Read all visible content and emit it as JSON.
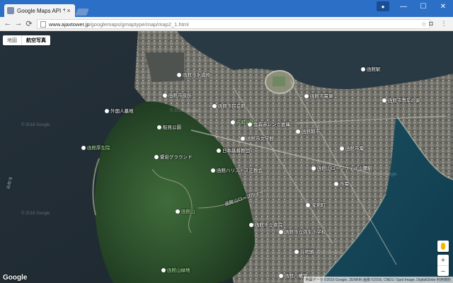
{
  "browser": {
    "tab_title": "Google Maps API サンプル",
    "tab_close": "×",
    "url_domain": "www.ajaxtower.jp",
    "url_path": "/googlemaps/gmaptype/map/map2_1.html",
    "window_minimize": "—",
    "window_maximize": "☐",
    "window_close": "✕",
    "back": "←",
    "forward": "→",
    "reload": "⟳",
    "star": "☆"
  },
  "map": {
    "type_controls": [
      "地図",
      "航空写真"
    ],
    "selected_type": "航空写真",
    "labels": [
      {
        "text": "函館市水道局"
      },
      {
        "text": "函館市役所"
      },
      {
        "text": "函館市民会館"
      },
      {
        "text": "函館市電車"
      },
      {
        "text": "函館市青年の家"
      },
      {
        "text": "外国人墓地"
      },
      {
        "text": "船見公園"
      },
      {
        "text": "函館厚生院"
      },
      {
        "text": "愛宕グラウンド"
      },
      {
        "text": "函館ハリストス正教会"
      },
      {
        "text": "日本基督教団"
      },
      {
        "text": "元町公園"
      },
      {
        "text": "函館山ロープウェイ"
      },
      {
        "text": "函館山"
      },
      {
        "text": "函館市立病院"
      },
      {
        "text": "函館山緑地"
      },
      {
        "text": "函館市立弥生小学校"
      },
      {
        "text": "函館朝市"
      },
      {
        "text": "函館駅"
      },
      {
        "text": "市電"
      },
      {
        "text": "宝来町"
      },
      {
        "text": "谷地頭"
      },
      {
        "text": "函館市文学館"
      },
      {
        "text": "函館山ロープウェイ山麓駅"
      },
      {
        "text": "函館八幡宮"
      },
      {
        "text": "金森赤レンガ倉庫"
      },
      {
        "text": "函館市電"
      }
    ],
    "sea_labels": [
      "函館湾"
    ],
    "watermark": "© 2016 Google",
    "google_logo": "Google",
    "attribution": "地図データ ©2016 Google, ZENRIN 画像 ©2016, CNES / Spot Image, DigitalGlobe  利用規約",
    "zoom_in": "+",
    "zoom_out": "−"
  }
}
